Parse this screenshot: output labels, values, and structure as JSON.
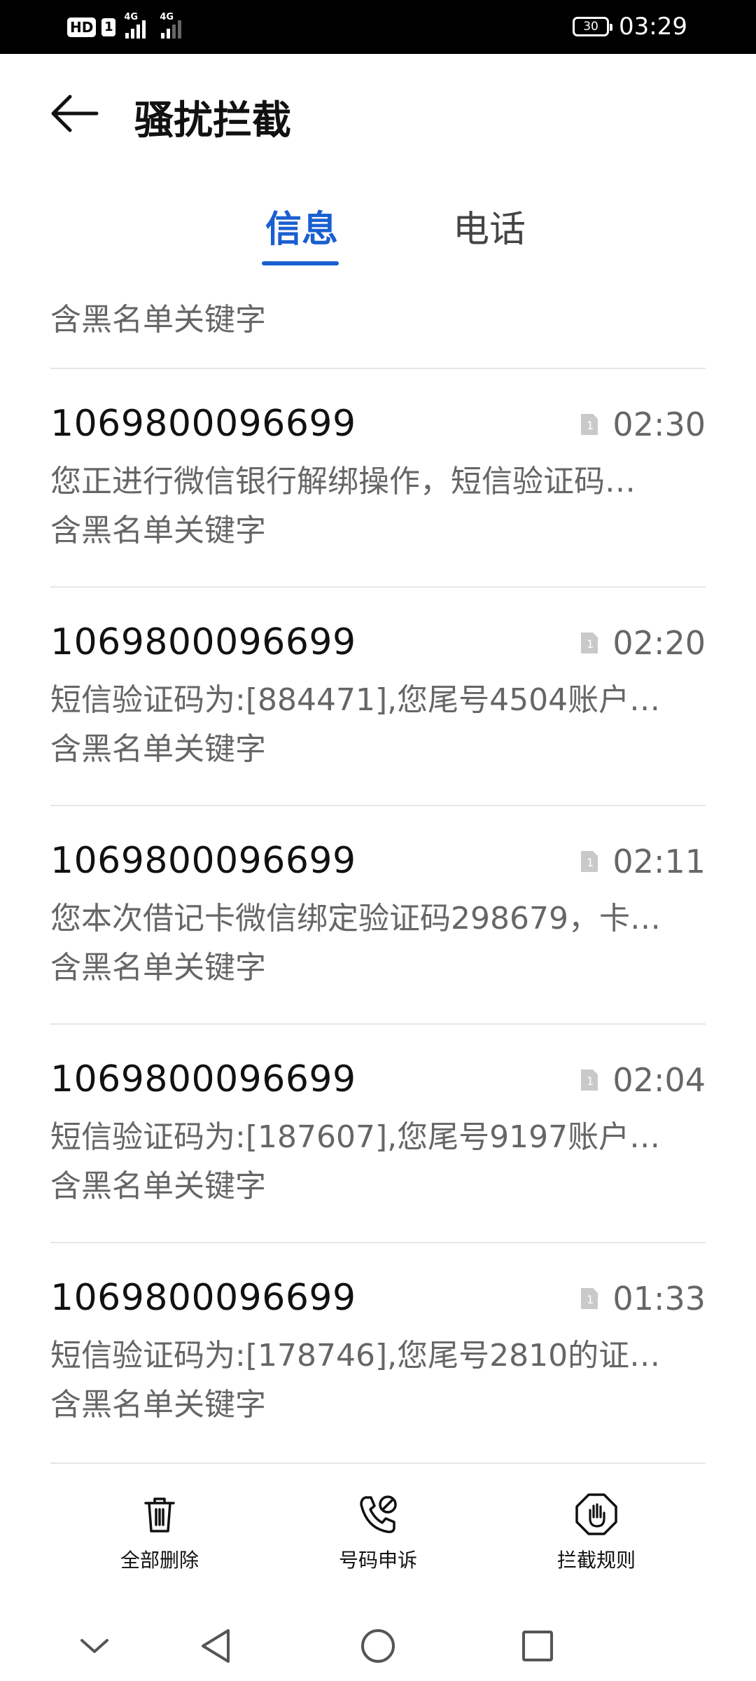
{
  "status_bar": {
    "hd": "HD",
    "sim": "1",
    "net1": "4G",
    "net2": "4G",
    "battery": "30",
    "time": "03:29"
  },
  "header": {
    "title": "骚扰拦截"
  },
  "tabs": [
    {
      "label": "信息",
      "active": true
    },
    {
      "label": "电话",
      "active": false
    }
  ],
  "list": {
    "partial_reason": "含黑名单关键字",
    "items": [
      {
        "sender": "1069800096699",
        "time": "02:30",
        "preview": "您正进行微信银行解绑操作，短信验证码…",
        "reason": "含黑名单关键字"
      },
      {
        "sender": "1069800096699",
        "time": "02:20",
        "preview": "短信验证码为:[884471],您尾号4504账户…",
        "reason": "含黑名单关键字"
      },
      {
        "sender": "1069800096699",
        "time": "02:11",
        "preview": "您本次借记卡微信绑定验证码298679，卡…",
        "reason": "含黑名单关键字"
      },
      {
        "sender": "1069800096699",
        "time": "02:04",
        "preview": "短信验证码为:[187607],您尾号9197账户…",
        "reason": "含黑名单关键字"
      },
      {
        "sender": "1069800096699",
        "time": "01:33",
        "preview": "短信验证码为:[178746],您尾号2810的证…",
        "reason": "含黑名单关键字"
      }
    ]
  },
  "actions": {
    "delete_all": "全部删除",
    "appeal": "号码申诉",
    "rules": "拦截规则"
  },
  "colors": {
    "accent": "#1a5fd1",
    "secondary_text": "#666666",
    "divider": "#e6e6e6"
  }
}
